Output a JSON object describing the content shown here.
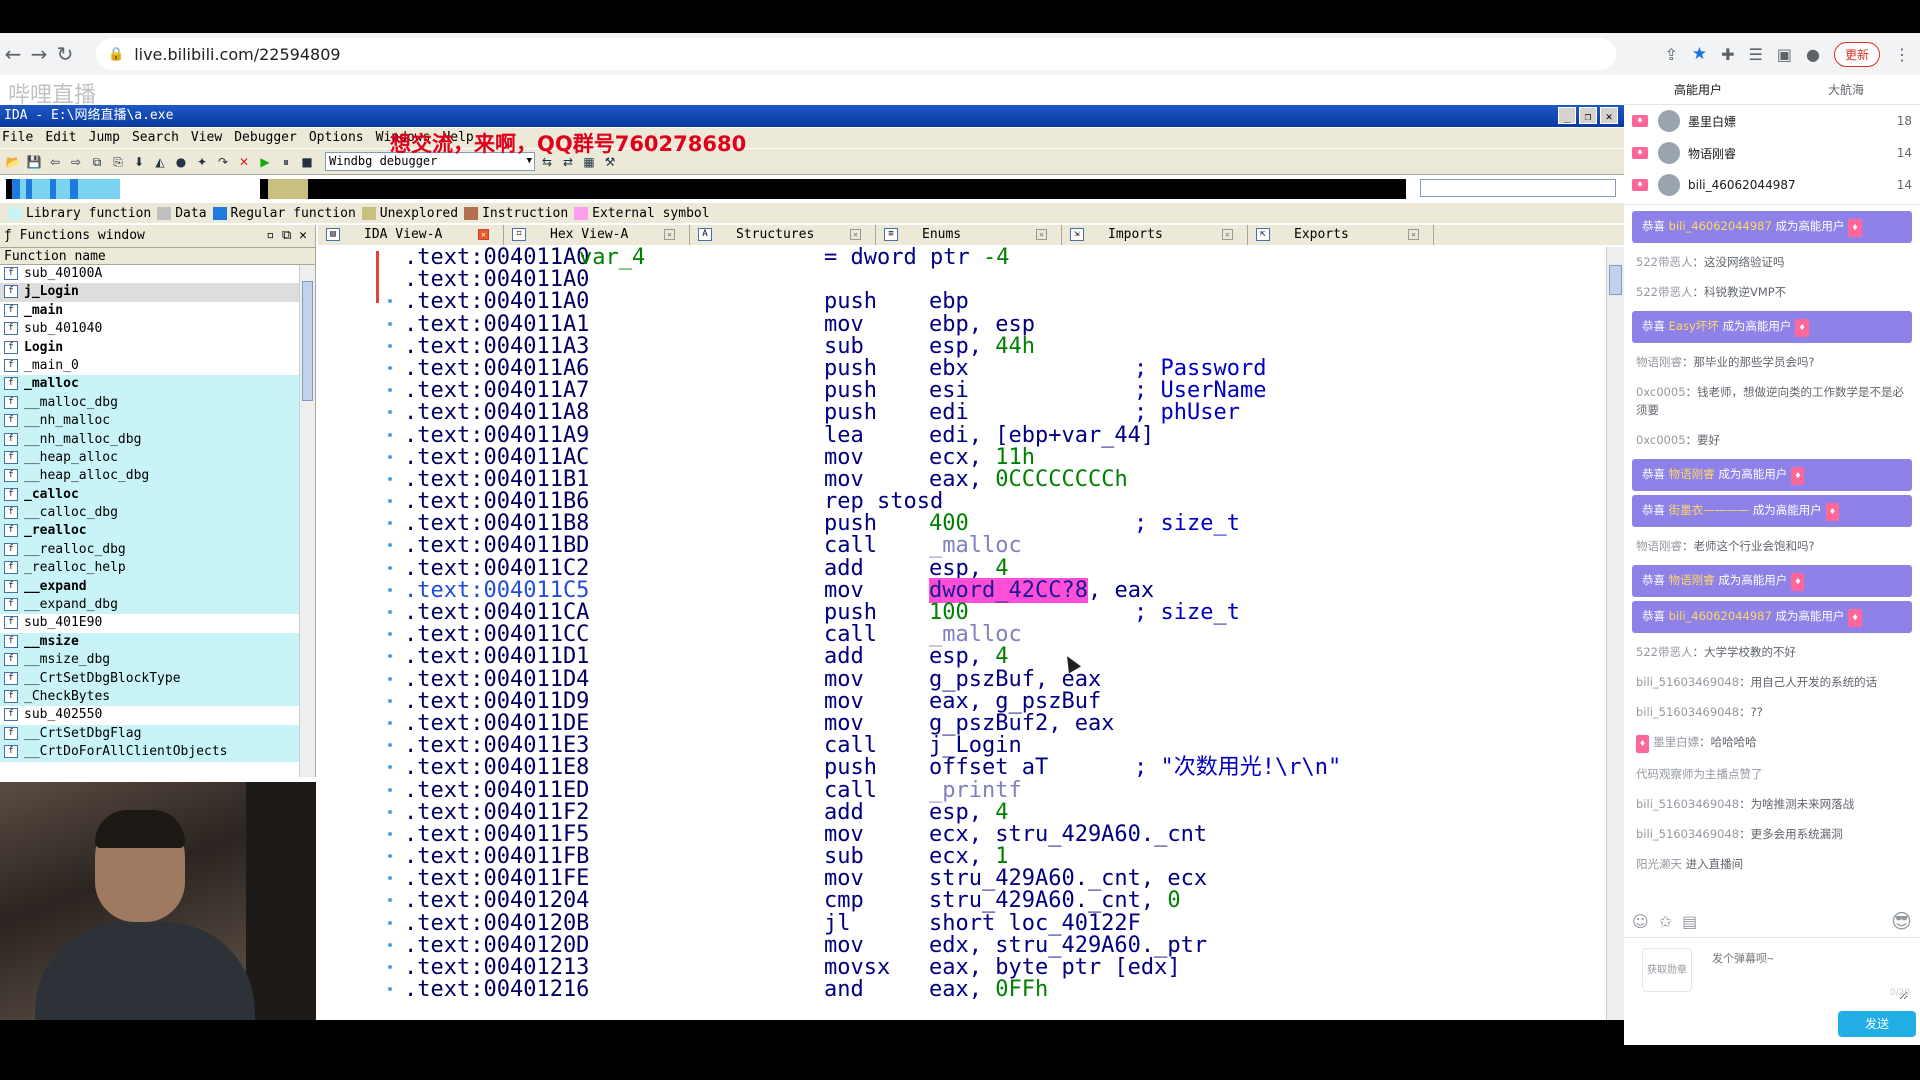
{
  "browser": {
    "url": "live.bilibili.com/22594809",
    "update_label": "更新"
  },
  "overlay": {
    "text": "想交流，来啊，QQ群号760278680",
    "watermark": "哔哩直播"
  },
  "ida": {
    "title": "IDA - E:\\网络直播\\a.exe",
    "menu": [
      "File",
      "Edit",
      "Jump",
      "Search",
      "View",
      "Debugger",
      "Options",
      "Windows",
      "Help"
    ],
    "debugger": "Windbg debugger",
    "legend": [
      {
        "label": "Library function",
        "color": "#c8f4f8"
      },
      {
        "label": "Data",
        "color": "#c0c0c0"
      },
      {
        "label": "Regular function",
        "color": "#1f7ae0"
      },
      {
        "label": "Unexplored",
        "color": "#c8c080"
      },
      {
        "label": "Instruction",
        "color": "#b07050"
      },
      {
        "label": "External symbol",
        "color": "#ff9ef0"
      }
    ],
    "functions_window": {
      "title": "Functions window",
      "column": "Function name",
      "items": [
        {
          "name": "sub_40100A",
          "type": "regular"
        },
        {
          "name": "j_Login",
          "type": "selected"
        },
        {
          "name": "_main",
          "type": "bold"
        },
        {
          "name": "sub_401040",
          "type": "regular"
        },
        {
          "name": "Login",
          "type": "bold"
        },
        {
          "name": "_main_0",
          "type": "regular"
        },
        {
          "name": "_malloc",
          "type": "libbold"
        },
        {
          "name": "__malloc_dbg",
          "type": "lib"
        },
        {
          "name": "__nh_malloc",
          "type": "lib"
        },
        {
          "name": "__nh_malloc_dbg",
          "type": "lib"
        },
        {
          "name": "__heap_alloc",
          "type": "lib"
        },
        {
          "name": "__heap_alloc_dbg",
          "type": "lib"
        },
        {
          "name": "_calloc",
          "type": "libbold"
        },
        {
          "name": "__calloc_dbg",
          "type": "lib"
        },
        {
          "name": "_realloc",
          "type": "libbold"
        },
        {
          "name": "__realloc_dbg",
          "type": "lib"
        },
        {
          "name": "_realloc_help",
          "type": "lib"
        },
        {
          "name": "__expand",
          "type": "libbold"
        },
        {
          "name": "__expand_dbg",
          "type": "lib"
        },
        {
          "name": "sub_401E90",
          "type": "regular"
        },
        {
          "name": "__msize",
          "type": "libbold"
        },
        {
          "name": "__msize_dbg",
          "type": "lib"
        },
        {
          "name": "__CrtSetDbgBlockType",
          "type": "lib"
        },
        {
          "name": "_CheckBytes",
          "type": "lib"
        },
        {
          "name": "sub_402550",
          "type": "regular"
        },
        {
          "name": "__CrtSetDbgFlag",
          "type": "lib"
        },
        {
          "name": "__CrtDoForAllClientObjects",
          "type": "lib"
        }
      ]
    },
    "tabs": [
      "IDA View-A",
      "Hex View-A",
      "Structures",
      "Enums",
      "Imports",
      "Exports"
    ],
    "code": [
      {
        "addr": ".text:004011A0",
        "var": "var_4",
        "mn": "",
        "op": "= dword ptr -4",
        "cm": ""
      },
      {
        "addr": ".text:004011A0",
        "var": "",
        "mn": "",
        "op": "",
        "cm": ""
      },
      {
        "addr": ".text:004011A0",
        "var": "",
        "mn": "push",
        "op": "ebp",
        "cm": ""
      },
      {
        "addr": ".text:004011A1",
        "var": "",
        "mn": "mov",
        "op": "ebp, esp",
        "cm": ""
      },
      {
        "addr": ".text:004011A3",
        "var": "",
        "mn": "sub",
        "op": "esp, 44h",
        "cm": ""
      },
      {
        "addr": ".text:004011A6",
        "var": "",
        "mn": "push",
        "op": "ebx",
        "cm": "; Password"
      },
      {
        "addr": ".text:004011A7",
        "var": "",
        "mn": "push",
        "op": "esi",
        "cm": "; UserName"
      },
      {
        "addr": ".text:004011A8",
        "var": "",
        "mn": "push",
        "op": "edi",
        "cm": "; phUser"
      },
      {
        "addr": ".text:004011A9",
        "var": "",
        "mn": "lea",
        "op": "edi, [ebp+var_44]",
        "cm": ""
      },
      {
        "addr": ".text:004011AC",
        "var": "",
        "mn": "mov",
        "op": "ecx, 11h",
        "cm": ""
      },
      {
        "addr": ".text:004011B1",
        "var": "",
        "mn": "mov",
        "op": "eax, 0CCCCCCCCh",
        "cm": ""
      },
      {
        "addr": ".text:004011B6",
        "var": "",
        "mn": "rep stosd",
        "op": "",
        "cm": ""
      },
      {
        "addr": ".text:004011B8",
        "var": "",
        "mn": "push",
        "op": "400",
        "cm": "; size_t"
      },
      {
        "addr": ".text:004011BD",
        "var": "",
        "mn": "call",
        "op": "_malloc",
        "cm": ""
      },
      {
        "addr": ".text:004011C2",
        "var": "",
        "mn": "add",
        "op": "esp, 4",
        "cm": ""
      },
      {
        "addr": ".text:004011C5",
        "var": "",
        "mn": "mov",
        "op": "dword_42CC?8, eax",
        "cm": ""
      },
      {
        "addr": ".text:004011CA",
        "var": "",
        "mn": "push",
        "op": "100",
        "cm": "; size_t"
      },
      {
        "addr": ".text:004011CC",
        "var": "",
        "mn": "call",
        "op": "_malloc",
        "cm": ""
      },
      {
        "addr": ".text:004011D1",
        "var": "",
        "mn": "add",
        "op": "esp, 4",
        "cm": ""
      },
      {
        "addr": ".text:004011D4",
        "var": "",
        "mn": "mov",
        "op": "g_pszBuf, eax",
        "cm": ""
      },
      {
        "addr": ".text:004011D9",
        "var": "",
        "mn": "mov",
        "op": "eax, g_pszBuf",
        "cm": ""
      },
      {
        "addr": ".text:004011DE",
        "var": "",
        "mn": "mov",
        "op": "g_pszBuf2, eax",
        "cm": ""
      },
      {
        "addr": ".text:004011E3",
        "var": "",
        "mn": "call",
        "op": "j_Login",
        "cm": ""
      },
      {
        "addr": ".text:004011E8",
        "var": "",
        "mn": "push",
        "op": "offset aT",
        "cm": "; \"次数用光!\\r\\n\""
      },
      {
        "addr": ".text:004011ED",
        "var": "",
        "mn": "call",
        "op": "_printf",
        "cm": ""
      },
      {
        "addr": ".text:004011F2",
        "var": "",
        "mn": "add",
        "op": "esp, 4",
        "cm": ""
      },
      {
        "addr": ".text:004011F5",
        "var": "",
        "mn": "mov",
        "op": "ecx, stru_429A60._cnt",
        "cm": ""
      },
      {
        "addr": ".text:004011FB",
        "var": "",
        "mn": "sub",
        "op": "ecx, 1",
        "cm": ""
      },
      {
        "addr": ".text:004011FE",
        "var": "",
        "mn": "mov",
        "op": "stru_429A60._cnt, ecx",
        "cm": ""
      },
      {
        "addr": ".text:00401204",
        "var": "",
        "mn": "cmp",
        "op": "stru_429A60._cnt, 0",
        "cm": ""
      },
      {
        "addr": ".text:0040120B",
        "var": "",
        "mn": "jl",
        "op": "short loc_40122F",
        "cm": ""
      },
      {
        "addr": ".text:0040120D",
        "var": "",
        "mn": "mov",
        "op": "edx, stru_429A60._ptr",
        "cm": ""
      },
      {
        "addr": ".text:00401213",
        "var": "",
        "mn": "movsx",
        "op": "eax, byte ptr [edx]",
        "cm": ""
      },
      {
        "addr": ".text:00401216",
        "var": "",
        "mn": "and",
        "op": "eax, 0FFh",
        "cm": ""
      }
    ]
  },
  "chat": {
    "tabs": [
      "高能用户",
      "大航海"
    ],
    "ranks": [
      {
        "name": "墨里白嫖",
        "count": "18"
      },
      {
        "name": "物语刚睿",
        "count": "14"
      },
      {
        "name": "bili_46062044987",
        "count": "14"
      }
    ],
    "messages": [
      {
        "kind": "notice",
        "pre": "恭喜",
        "user": "bili_46062044987",
        "text": "成为高能用户"
      },
      {
        "kind": "msg",
        "user": "522带恶人",
        "text": "：这没网络验证吗"
      },
      {
        "kind": "msg",
        "user": "522带恶人",
        "text": "：科锐教逆VMP不"
      },
      {
        "kind": "notice",
        "pre": "恭喜",
        "user": "Easy坏坏",
        "text": "成为高能用户"
      },
      {
        "kind": "msg",
        "user": "物语刚睿",
        "text": "：那毕业的那些学员会吗?"
      },
      {
        "kind": "msg",
        "user": "0xc0005",
        "text": "：钱老师，想做逆向类的工作数学是不是必须要"
      },
      {
        "kind": "msg",
        "user": "0xc0005",
        "text": "：要好"
      },
      {
        "kind": "notice",
        "pre": "恭喜",
        "user": "物语刚睿",
        "text": "成为高能用户"
      },
      {
        "kind": "notice",
        "pre": "恭喜",
        "user": "街墨衣————",
        "text": "成为高能用户"
      },
      {
        "kind": "msg",
        "user": "物语刚睿",
        "text": "：老师这个行业会饱和吗?"
      },
      {
        "kind": "notice",
        "pre": "恭喜",
        "user": "物语刚睿",
        "text": "成为高能用户"
      },
      {
        "kind": "notice",
        "pre": "恭喜",
        "user": "bili_46062044987",
        "text": "成为高能用户"
      },
      {
        "kind": "msg",
        "user": "522带恶人",
        "text": "：大学学校教的不好"
      },
      {
        "kind": "msg",
        "user": "bili_51603469048",
        "text": "：用自己人开发的系统的话"
      },
      {
        "kind": "msg",
        "user": "bili_51603469048",
        "text": "：??"
      },
      {
        "kind": "lvl",
        "user": "墨里白嫖",
        "text": "：哈哈哈哈"
      },
      {
        "kind": "msg",
        "user": "代码观察师为主播点赞了",
        "text": ""
      },
      {
        "kind": "msg",
        "user": "bili_51603469048",
        "text": "：为啥推测未来网落战"
      },
      {
        "kind": "msg",
        "user": "bili_51603469048",
        "text": "：更多会用系统漏洞"
      },
      {
        "kind": "msg",
        "user": "阳光濑天",
        "text": " 进入直播间"
      }
    ],
    "medal_label": "获取勋章",
    "input_placeholder": "发个弹幕呗~",
    "char_count": "0/20",
    "send_label": "发送"
  }
}
